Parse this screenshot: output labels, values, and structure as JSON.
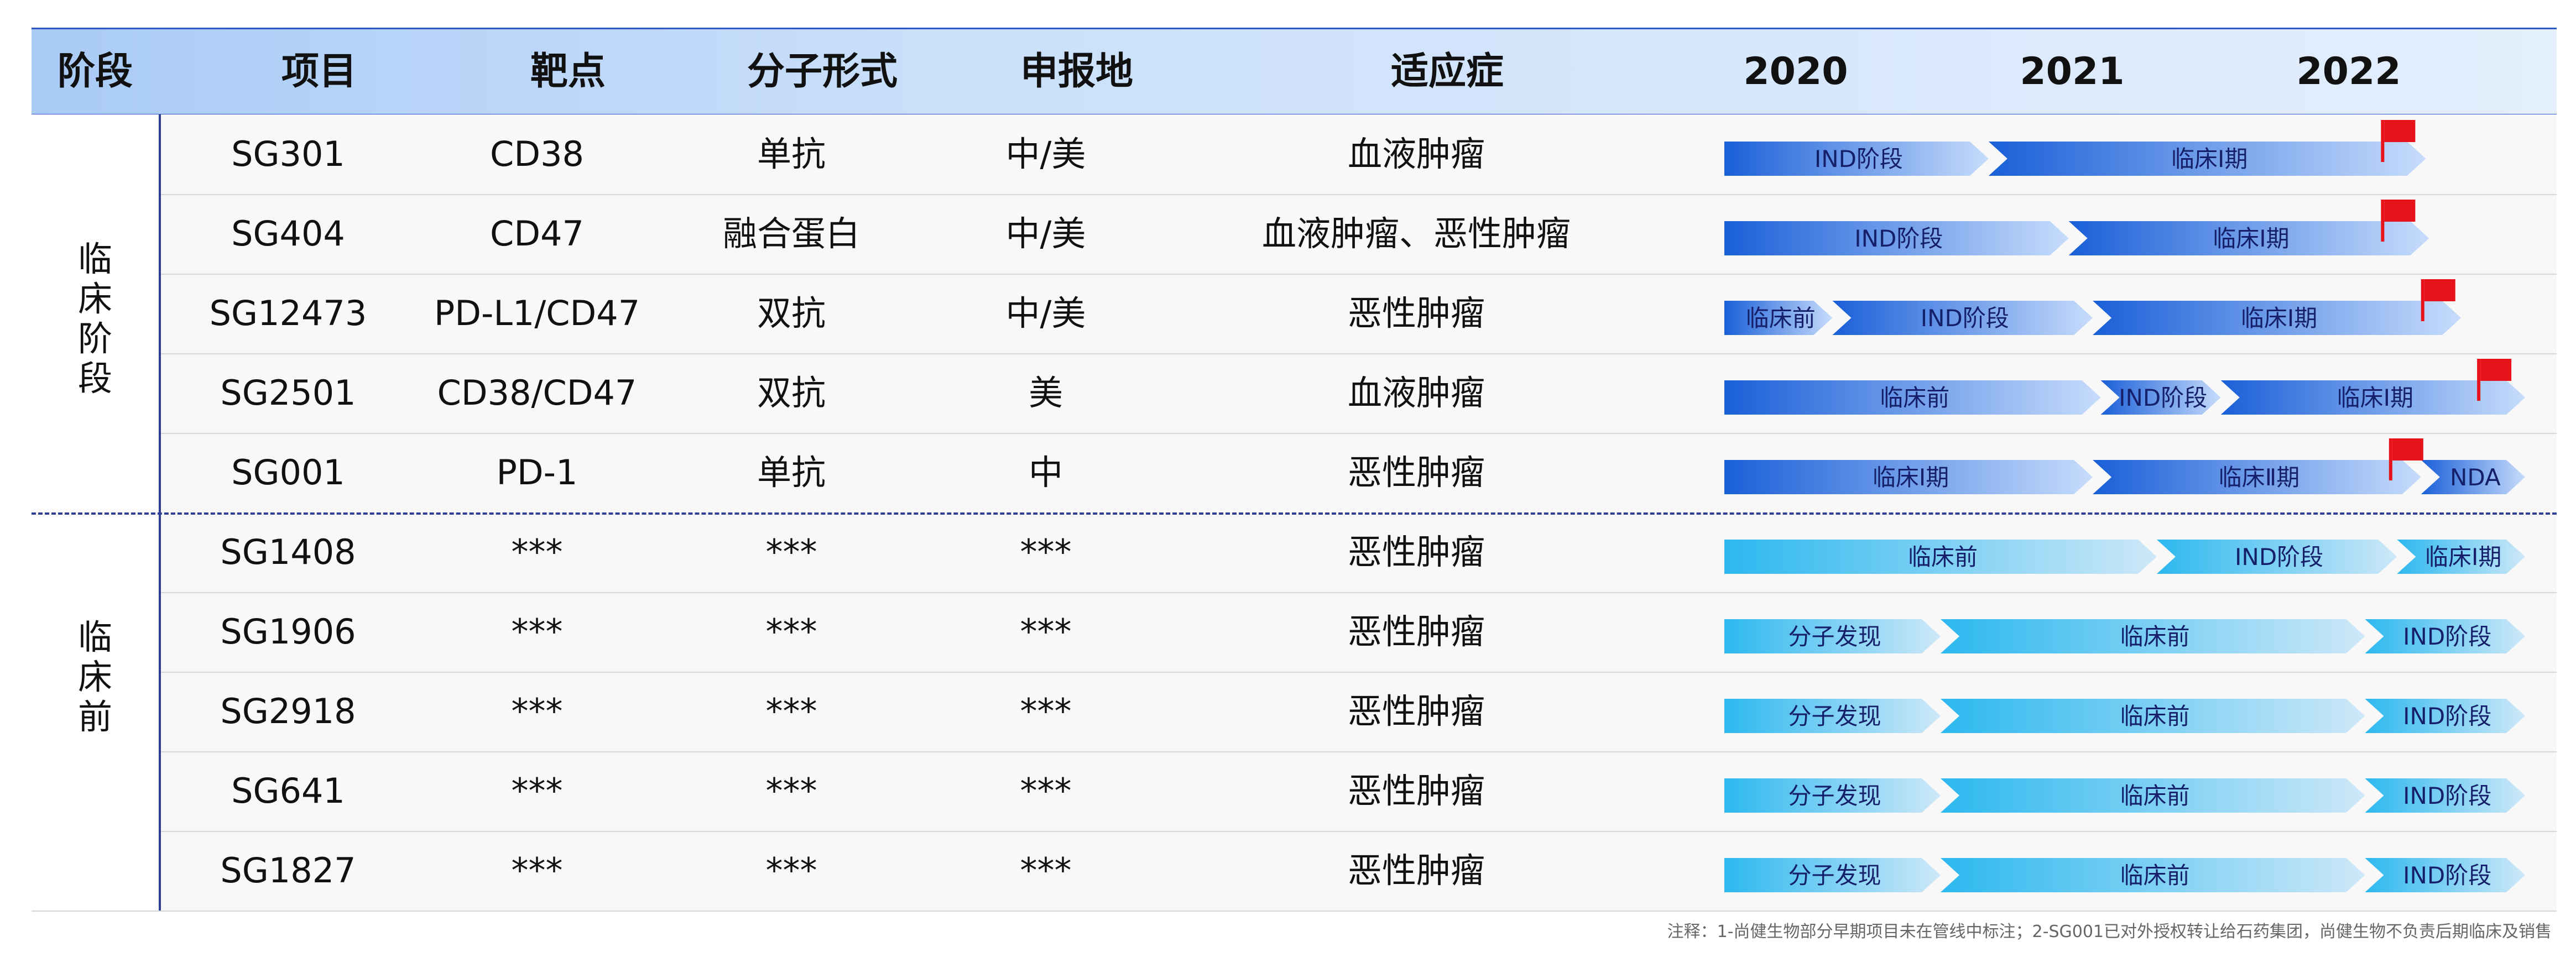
{
  "headers": {
    "stage": "阶段",
    "project": "项目",
    "target": "靶点",
    "form": "分子形式",
    "region": "申报地",
    "indication": "适应症",
    "years": [
      "2020",
      "2021",
      "2022"
    ]
  },
  "stages": [
    {
      "label": "临床阶段"
    },
    {
      "label": "临床前"
    }
  ],
  "rows": [
    {
      "project": "SG301",
      "target": "CD38",
      "form": "单抗",
      "region": "中/美",
      "indication": "血液肿瘤",
      "segments": [
        {
          "label": "IND阶段",
          "start": 0,
          "end": 0.33
        },
        {
          "label": "临床Ⅰ期",
          "start": 0.33,
          "end": 0.876
        }
      ],
      "flag": 0.82
    },
    {
      "project": "SG404",
      "target": "CD47",
      "form": "融合蛋白",
      "region": "中/美",
      "indication": "血液肿瘤、恶性肿瘤",
      "segments": [
        {
          "label": "IND阶段",
          "start": 0,
          "end": 0.43
        },
        {
          "label": "临床Ⅰ期",
          "start": 0.43,
          "end": 0.88
        }
      ],
      "flag": 0.82
    },
    {
      "project": "SG12473",
      "target": "PD-L1/CD47",
      "form": "双抗",
      "region": "中/美",
      "indication": "恶性肿瘤",
      "segments": [
        {
          "label": "临床前",
          "start": 0,
          "end": 0.135
        },
        {
          "label": "IND阶段",
          "start": 0.135,
          "end": 0.46
        },
        {
          "label": "临床Ⅰ期",
          "start": 0.46,
          "end": 0.92
        }
      ],
      "flag": 0.87
    },
    {
      "project": "SG2501",
      "target": "CD38/CD47",
      "form": "双抗",
      "region": "美",
      "indication": "血液肿瘤",
      "segments": [
        {
          "label": "临床前",
          "start": 0,
          "end": 0.47
        },
        {
          "label": "IND阶段",
          "start": 0.47,
          "end": 0.62
        },
        {
          "label": "临床Ⅰ期",
          "start": 0.62,
          "end": 1.0
        }
      ],
      "flag": 0.94
    },
    {
      "project": "SG001",
      "target": "PD-1",
      "form": "单抗",
      "region": "中",
      "indication": "恶性肿瘤",
      "segments": [
        {
          "label": "临床Ⅰ期",
          "start": 0,
          "end": 0.46
        },
        {
          "label": "临床Ⅱ期",
          "start": 0.46,
          "end": 0.87
        },
        {
          "label": "NDA",
          "start": 0.87,
          "end": 1.0
        }
      ],
      "flag": 0.83
    },
    {
      "project": "SG1408",
      "target": "***",
      "form": "***",
      "region": "***",
      "indication": "恶性肿瘤",
      "segments": [
        {
          "label": "临床前",
          "start": 0,
          "end": 0.54
        },
        {
          "label": "IND阶段",
          "start": 0.54,
          "end": 0.84
        },
        {
          "label": "临床Ⅰ期",
          "start": 0.84,
          "end": 1.0
        }
      ]
    },
    {
      "project": "SG1906",
      "target": "***",
      "form": "***",
      "region": "***",
      "indication": "恶性肿瘤",
      "segments": [
        {
          "label": "分子发现",
          "start": 0,
          "end": 0.27
        },
        {
          "label": "临床前",
          "start": 0.27,
          "end": 0.8
        },
        {
          "label": "IND阶段",
          "start": 0.8,
          "end": 1.0
        }
      ]
    },
    {
      "project": "SG2918",
      "target": "***",
      "form": "***",
      "region": "***",
      "indication": "恶性肿瘤",
      "segments": [
        {
          "label": "分子发现",
          "start": 0,
          "end": 0.27
        },
        {
          "label": "临床前",
          "start": 0.27,
          "end": 0.8
        },
        {
          "label": "IND阶段",
          "start": 0.8,
          "end": 1.0
        }
      ]
    },
    {
      "project": "SG641",
      "target": "***",
      "form": "***",
      "region": "***",
      "indication": "恶性肿瘤",
      "segments": [
        {
          "label": "分子发现",
          "start": 0,
          "end": 0.27
        },
        {
          "label": "临床前",
          "start": 0.27,
          "end": 0.8
        },
        {
          "label": "IND阶段",
          "start": 0.8,
          "end": 1.0
        }
      ]
    },
    {
      "project": "SG1827",
      "target": "***",
      "form": "***",
      "region": "***",
      "indication": "恶性肿瘤",
      "segments": [
        {
          "label": "分子发现",
          "start": 0,
          "end": 0.27
        },
        {
          "label": "临床前",
          "start": 0.27,
          "end": 0.8
        },
        {
          "label": "IND阶段",
          "start": 0.8,
          "end": 1.0
        }
      ]
    }
  ],
  "colors": {
    "clinical_dark": "#1a5fd8",
    "clinical_light": "#c6dcfb",
    "preclinical_dark": "#2cb8ef",
    "preclinical_light": "#cde8f8",
    "flag": "#e8121b",
    "rule": "#2e3f96"
  },
  "footnote": "注释：1-尚健生物部分早期项目未在管线中标注；2-SG001已对外授权转让给石药集团，尚健生物不负责后期临床及销售"
}
